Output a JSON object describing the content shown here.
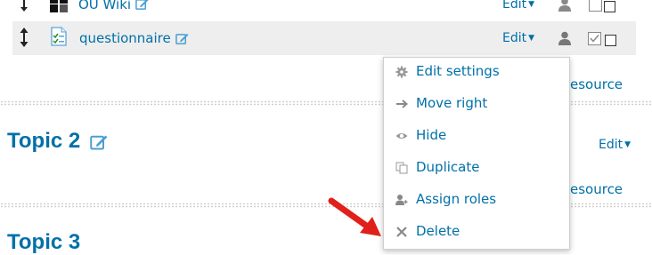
{
  "top_row": {
    "name": "OU Wiki",
    "edit_label": "Edit"
  },
  "questionnaire_row": {
    "name": "questionnaire",
    "edit_label": "Edit"
  },
  "menu": {
    "items": [
      {
        "label": "Edit settings",
        "icon": "gear-icon"
      },
      {
        "label": "Move right",
        "icon": "arrow-right-icon"
      },
      {
        "label": "Hide",
        "icon": "eye-icon"
      },
      {
        "label": "Duplicate",
        "icon": "duplicate-icon"
      },
      {
        "label": "Assign roles",
        "icon": "assign-roles-icon"
      },
      {
        "label": "Delete",
        "icon": "close-icon"
      }
    ]
  },
  "side_labels": {
    "add_resource_1": "esource",
    "add_resource_2": "esource"
  },
  "topic2": {
    "title": "Topic 2",
    "edit_label": "Edit"
  },
  "topic3": {
    "title": "Topic 3"
  },
  "colors": {
    "link": "#0070a8",
    "row_highlight": "#eeeeee",
    "arrow": "#e0201b"
  }
}
